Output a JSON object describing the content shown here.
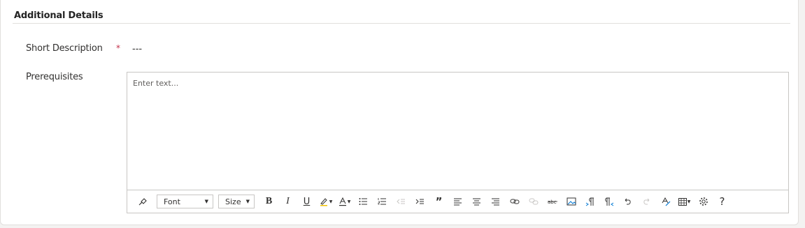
{
  "section": {
    "title": "Additional Details"
  },
  "fields": {
    "short_description": {
      "label": "Short Description",
      "required_marker": "*",
      "value": "---"
    },
    "prerequisites": {
      "label": "Prerequisites",
      "placeholder": "Enter text..."
    }
  },
  "toolbar": {
    "font_label": "Font",
    "size_label": "Size",
    "bold_label": "B",
    "italic_label": "I",
    "underline_label": "U",
    "quote_label": "”",
    "help_label": "?",
    "icons": [
      "format-painter-icon",
      "highlight-icon",
      "font-color-icon",
      "bulleted-list-icon",
      "numbered-list-icon",
      "decrease-indent-icon",
      "increase-indent-icon",
      "quote-icon",
      "align-left-icon",
      "align-center-icon",
      "align-right-icon",
      "link-icon",
      "unlink-icon",
      "strikethrough-icon",
      "image-icon",
      "ltr-icon",
      "rtl-icon",
      "undo-icon",
      "redo-icon",
      "clear-format-icon",
      "table-icon",
      "settings-icon",
      "help-icon"
    ]
  },
  "colors": {
    "required": "#c4314b",
    "border": "#c8c6c4",
    "divider": "#e1dfdd",
    "background": "#f3f2f1"
  }
}
